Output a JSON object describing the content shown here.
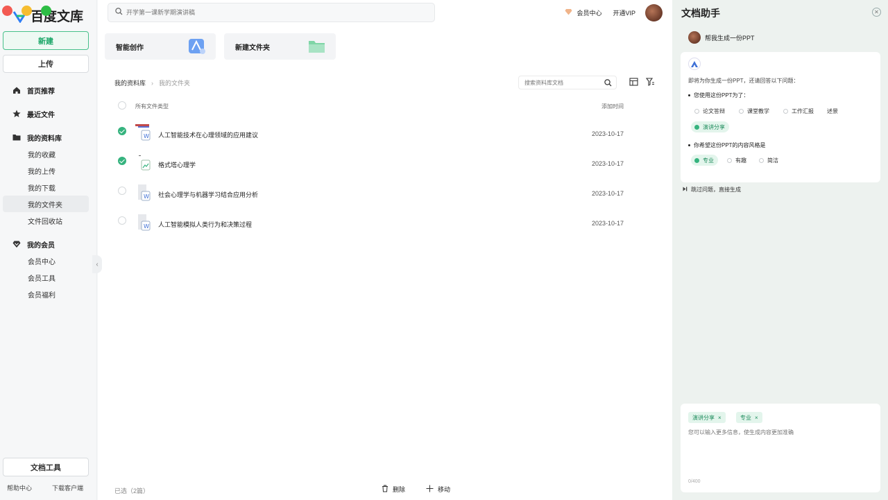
{
  "sidebar": {
    "logo_text": "百度文库",
    "new_label": "新建",
    "upload_label": "上传",
    "nav": {
      "home": "首页推荐",
      "recent": "最近文件",
      "library": "我的资料库",
      "library_items": [
        "我的收藏",
        "我的上传",
        "我的下载",
        "我的文件夹",
        "文件回收站"
      ],
      "member": "我的会员",
      "member_items": [
        "会员中心",
        "会员工具",
        "会员福利"
      ]
    },
    "tools_label": "文档工具",
    "help_label": "帮助中心",
    "download_client_label": "下载客户端"
  },
  "header": {
    "search_placeholder": "开学第一课新学期演讲稿",
    "member_center": "会员中心",
    "open_vip": "开通VIP"
  },
  "cards": {
    "smart_create": "智能创作",
    "new_folder": "新建文件夹"
  },
  "breadcrumb": {
    "root": "我的资料库",
    "current": "我的文件夹"
  },
  "library_search_placeholder": "搜索资料库文档",
  "table": {
    "col_type": "所有文件类型",
    "col_time": "添加时间",
    "rows": [
      {
        "name": "人工智能技术在心理领域的应用建议",
        "date": "2023-10-17",
        "checked": true
      },
      {
        "name": "格式塔心理学",
        "date": "2023-10-17",
        "checked": true
      },
      {
        "name": "社会心理学与机器学习结合应用分析",
        "date": "2023-10-17",
        "checked": false
      },
      {
        "name": "人工智能模拟人类行为和决策过程",
        "date": "2023-10-17",
        "checked": false
      }
    ]
  },
  "bottom": {
    "selected": "已选（2篇）",
    "delete": "删除",
    "move": "移动"
  },
  "assistant": {
    "title": "文档助手",
    "user_message": "帮我生成一份PPT",
    "intro": "即将为你生成一份PPT，还请回答以下问题：",
    "q1": "您使用这份PPT为了：",
    "q1_options": [
      "论文答辩",
      "课堂教学",
      "工作汇报",
      "述景",
      "演讲分享"
    ],
    "q1_selected": "演讲分享",
    "q2": "你希望这份PPT的内容风格是",
    "q2_options": [
      "专业",
      "有趣",
      "简洁"
    ],
    "q2_selected": "专业",
    "skip": "跳过问题，直接生成",
    "tags": [
      "演讲分享",
      "专业"
    ],
    "input_placeholder": "您可以输入更多信息，使生成内容更加准确",
    "counter": "0/400"
  },
  "colors": {
    "accent": "#35b37e",
    "panel_bg": "#edf2ef"
  }
}
